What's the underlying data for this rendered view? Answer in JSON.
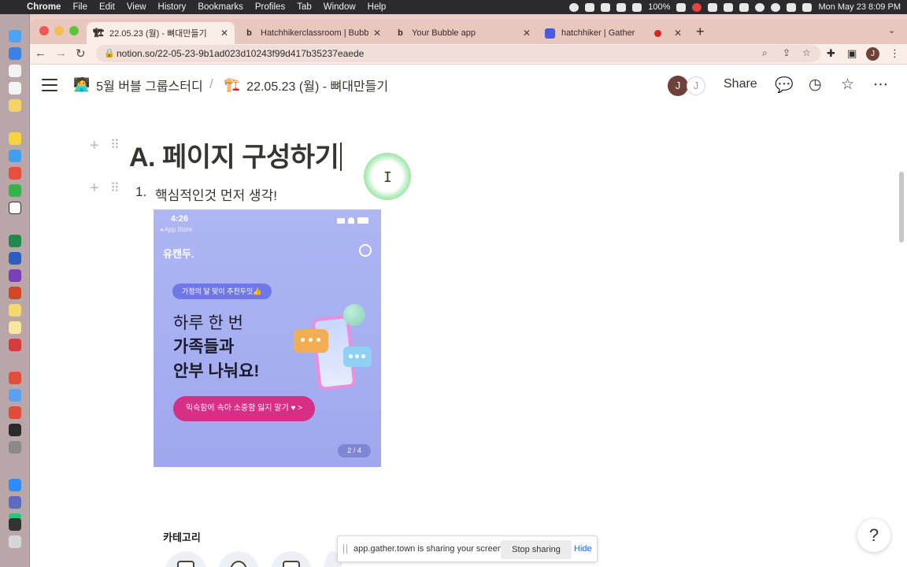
{
  "menubar": {
    "app": "Chrome",
    "items": [
      "File",
      "Edit",
      "View",
      "History",
      "Bookmarks",
      "Profiles",
      "Tab",
      "Window",
      "Help"
    ],
    "battery": "100%",
    "datetime": "Mon May 23  8:09 PM"
  },
  "tabs": [
    {
      "title": "22.05.23 (월) - 뼈대만들기",
      "active": true
    },
    {
      "title": "Hatchhikerclassroom | Bubble",
      "favicon": "b"
    },
    {
      "title": "Your Bubble app",
      "favicon": "b"
    },
    {
      "title": "hatchhiker | Gather",
      "recording": true
    }
  ],
  "address": {
    "url": "notion.so/22-05-23-9b1ad023d10243f99d417b35237eaede"
  },
  "profile_initial": "J",
  "notion": {
    "breadcrumb": [
      {
        "emoji": "🧑‍💻",
        "label": "5월 버블 그룹스터디"
      },
      {
        "emoji": "🏗️",
        "label": "22.05.23 (월) - 뼈대만들기"
      }
    ],
    "breadcrumb_sep": "/",
    "avatars": [
      "J",
      "J"
    ],
    "share_label": "Share",
    "heading": "A. 페이지 구성하기",
    "list_number": "1.",
    "list_text": "핵심적인것 먼저 생각!",
    "help_label": "?"
  },
  "screenshot": {
    "time": "4:26",
    "store": "◂ App Store",
    "brand": "유캔두.",
    "pill": "가정의 달 맞이 추천두잇👍",
    "headline": [
      "하루 한 번",
      "가족들과",
      "안부 나눠요!"
    ],
    "cta": "익숙함에 속아 소중함 잃지 말기 ♥  >",
    "pager": "2 / 4",
    "category": "카테고리"
  },
  "sharebar": {
    "message": "app.gather.town is sharing your screen.",
    "stop_label": "Stop sharing",
    "hide_label": "Hide"
  },
  "colors": {
    "tab_bar": "#e8c7bf",
    "toolbar": "#fbeee9",
    "menubar": "#2b2b2e",
    "screenshot_bg": "#aeb6f3",
    "cta": "#d52f86",
    "link": "#1a6fe0"
  }
}
